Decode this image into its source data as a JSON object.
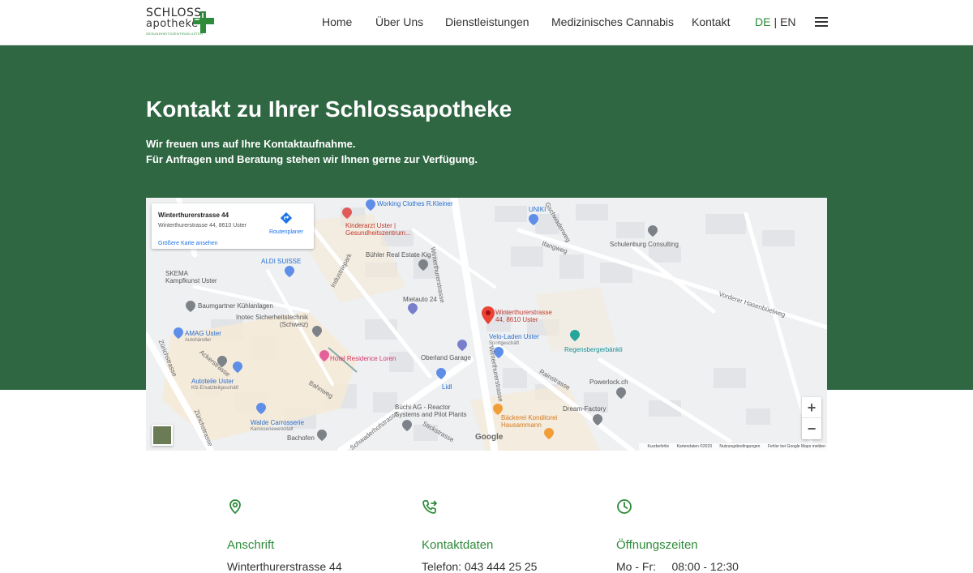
{
  "logo": {
    "line1": "SCHLOSS",
    "line2": "apotheke",
    "line3": "GESUNDHEITSZENTRUM USTER"
  },
  "nav": {
    "items": [
      "Home",
      "Über Uns",
      "Dienstleistungen",
      "Medizinisches Cannabis",
      "Kontakt"
    ]
  },
  "lang": {
    "de": "DE",
    "sep": "|",
    "en": "EN"
  },
  "hero": {
    "title": "Kontakt zu Ihrer Schlossapotheke",
    "line1": "Wir freuen uns auf Ihre Kontaktaufnahme.",
    "line2": "Für Anfragen und Beratung stehen wir Ihnen gerne zur Verfügung."
  },
  "map": {
    "card": {
      "title": "Winterthurerstrasse 44",
      "address": "Winterthurerstrasse 44, 8610 Uster",
      "route": "Routenplaner",
      "bigger": "Größere Karte ansehen"
    },
    "marker": {
      "line1": "Winterthurerstrasse",
      "line2": "44, 8610 Uster"
    },
    "places": {
      "working": "Working Clothes R.Kleiner",
      "kinderarzt1": "Kinderarzt Uster |",
      "kinderarzt2": "Gesundheitszentrum...",
      "uniki": "UNIKI",
      "aldi": "ALDI SUISSE",
      "buehler": "Bühler Real Estate Kig",
      "schulenburg": "Schulenburg Consulting",
      "skema1": "SKEMA",
      "skema2": "Kampfkunst Uster",
      "baumgartner": "Baumgartner Kühlanlagen",
      "inotec1": "Inotec Sicherheitstechnik",
      "inotec2": "(Schweiz)",
      "mietauto": "Mietauto 24",
      "amag1": "AMAG Uster",
      "amag2": "Autohändler",
      "hotel": "Hotel Residence Loren",
      "velo1": "Velo-Laden Uster",
      "velo2": "Sportgeschäft",
      "regensberger": "Regensbergerbänkli",
      "oberland": "Oberland Garage",
      "lidl": "Lidl",
      "autoteile1": "Autoteile Uster",
      "autoteile2": "Kfz-Ersatzteilgeschäft",
      "powerlock": "Powerlock.ch",
      "buechi1": "Büchi AG - Reactor",
      "buechi2": "Systems and Pilot Plants",
      "dream": "Dream-Factory",
      "walde1": "Walde Carrosserie",
      "walde2": "Karosseriewerkstatt",
      "baeckerei1": "Bäckerei Konditorei",
      "baeckerei2": "Hausammann",
      "bachofen": "Bachofen"
    },
    "streets": {
      "winterthurer1": "Winterthurerstrasse",
      "winterthurer2": "Winterthurerstrasse",
      "zuerich1": "Zürichstrasse",
      "zuerich2": "Zürichstrasse",
      "schwaderhof": "Schwaderhofstrasse",
      "ifangweg": "Ifangweg",
      "gschwaderweg": "Gschwaderweg",
      "industriepark": "Industriepark",
      "rainstrasse": "Rainstrasse",
      "stickstrasse": "Stickstrasse",
      "bahnweg": "Bahnweg",
      "ackerstrasse": "Ackerstrasse",
      "hasenbuel": "Vorderer Hasenbüelweg"
    },
    "google": "Google",
    "attrib": [
      "Kurzbefehle",
      "Kartendaten ©2023",
      "Nutzungsbedingungen",
      "Fehler bei Google Maps melden"
    ],
    "zoom_in": "+",
    "zoom_out": "−"
  },
  "contact": {
    "address": {
      "title": "Anschrift",
      "line": "Winterthurerstrasse 44"
    },
    "details": {
      "title": "Kontaktdaten",
      "line": "Telefon: 043 444 25 25"
    },
    "hours": {
      "title": "Öffnungszeiten",
      "line": "Mo - Fr:     08:00 - 12:30"
    }
  },
  "colors": {
    "brand_green": "#2e8b3a",
    "hero_bg": "#2f6742"
  }
}
